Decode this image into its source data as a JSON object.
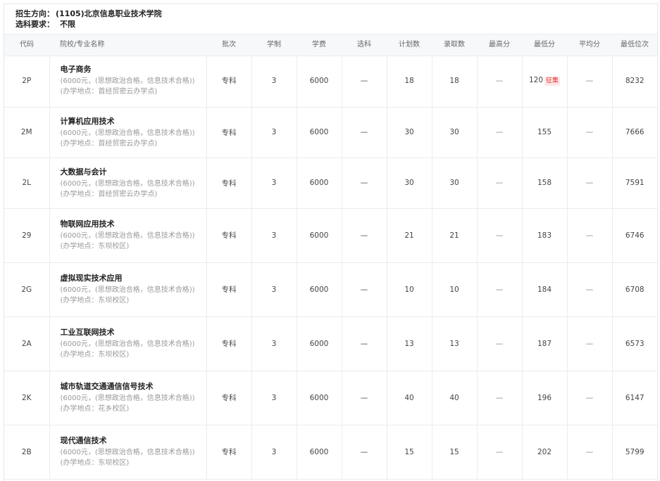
{
  "info": {
    "direction_label": "招生方向：",
    "direction_value": "(1105)北京信息职业技术学院",
    "subject_label": "选科要求：",
    "subject_value": "不限"
  },
  "headers": [
    "代码",
    "院校/专业名称",
    "批次",
    "学制",
    "学费",
    "选科",
    "计划数",
    "录取数",
    "最高分",
    "最低分",
    "平均分",
    "最低位次"
  ],
  "rows": [
    {
      "code": "2P",
      "name": "电子商务",
      "desc": "(6000元，(思想政治合格，信息技术合格))(办学地点：首经贸密云办学点)",
      "batch": "专科",
      "years": "3",
      "fee": "6000",
      "subject": "—",
      "plan": "18",
      "admit": "18",
      "max": "—",
      "min": "120",
      "tag": "征集",
      "avg": "—",
      "rank": "8232"
    },
    {
      "code": "2M",
      "name": "计算机应用技术",
      "desc": "(6000元，(思想政治合格，信息技术合格))(办学地点：首经贸密云办学点)",
      "batch": "专科",
      "years": "3",
      "fee": "6000",
      "subject": "—",
      "plan": "30",
      "admit": "30",
      "max": "—",
      "min": "155",
      "tag": "",
      "avg": "—",
      "rank": "7666"
    },
    {
      "code": "2L",
      "name": "大数据与会计",
      "desc": "(6000元，(思想政治合格，信息技术合格))(办学地点：首经贸密云办学点)",
      "batch": "专科",
      "years": "3",
      "fee": "6000",
      "subject": "—",
      "plan": "30",
      "admit": "30",
      "max": "—",
      "min": "158",
      "tag": "",
      "avg": "—",
      "rank": "7591"
    },
    {
      "code": "29",
      "name": "物联网应用技术",
      "desc": "(6000元，(思想政治合格，信息技术合格))(办学地点：东坝校区)",
      "batch": "专科",
      "years": "3",
      "fee": "6000",
      "subject": "—",
      "plan": "21",
      "admit": "21",
      "max": "—",
      "min": "183",
      "tag": "",
      "avg": "—",
      "rank": "6746"
    },
    {
      "code": "2G",
      "name": "虚拟现实技术应用",
      "desc": "(6000元，(思想政治合格，信息技术合格))(办学地点：东坝校区)",
      "batch": "专科",
      "years": "3",
      "fee": "6000",
      "subject": "—",
      "plan": "10",
      "admit": "10",
      "max": "—",
      "min": "184",
      "tag": "",
      "avg": "—",
      "rank": "6708"
    },
    {
      "code": "2A",
      "name": "工业互联网技术",
      "desc": "(6000元，(思想政治合格，信息技术合格))(办学地点：东坝校区)",
      "batch": "专科",
      "years": "3",
      "fee": "6000",
      "subject": "—",
      "plan": "13",
      "admit": "13",
      "max": "—",
      "min": "187",
      "tag": "",
      "avg": "—",
      "rank": "6573"
    },
    {
      "code": "2K",
      "name": "城市轨道交通通信信号技术",
      "desc": "(6000元，(思想政治合格，信息技术合格))(办学地点：花乡校区)",
      "batch": "专科",
      "years": "3",
      "fee": "6000",
      "subject": "—",
      "plan": "40",
      "admit": "40",
      "max": "—",
      "min": "196",
      "tag": "",
      "avg": "—",
      "rank": "6147"
    },
    {
      "code": "2B",
      "name": "现代通信技术",
      "desc": "(6000元，(思想政治合格，信息技术合格))(办学地点：东坝校区)",
      "batch": "专科",
      "years": "3",
      "fee": "6000",
      "subject": "—",
      "plan": "15",
      "admit": "15",
      "max": "—",
      "min": "202",
      "tag": "",
      "avg": "—",
      "rank": "5799"
    }
  ]
}
